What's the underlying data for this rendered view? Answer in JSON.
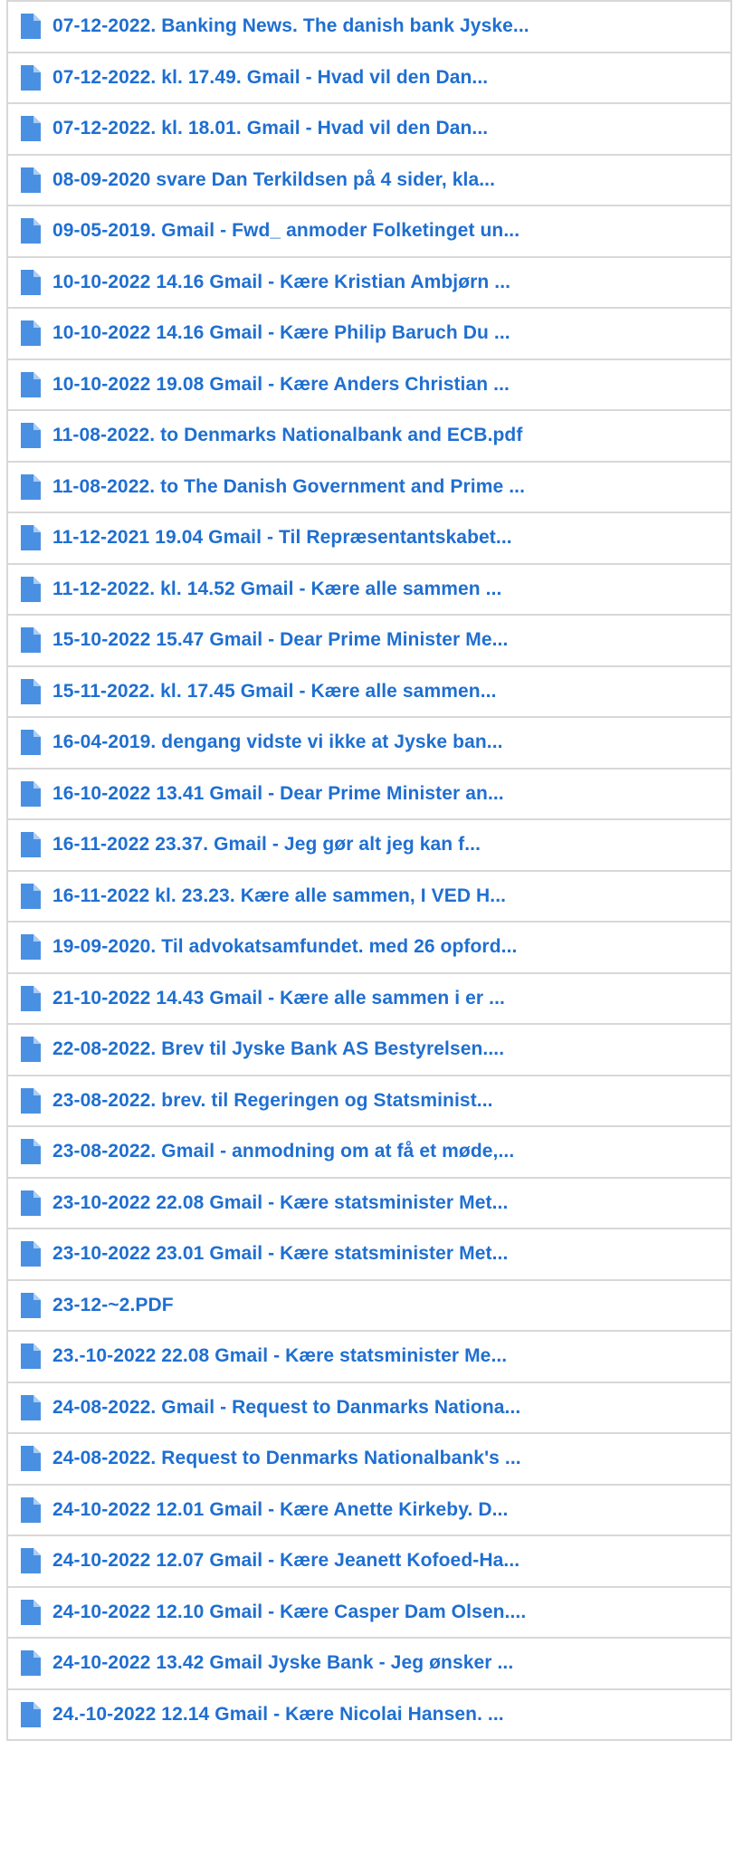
{
  "colors": {
    "link": "#1f6fd1",
    "icon": "#4a90e2",
    "border": "#d8d8d8"
  },
  "icon_name": "document-icon",
  "files": [
    {
      "label": "07-12-2022. Banking News. The danish bank Jyske..."
    },
    {
      "label": "07-12-2022. kl. 17.49. Gmail - Hvad vil den Dan..."
    },
    {
      "label": "07-12-2022. kl. 18.01. Gmail - Hvad vil den Dan..."
    },
    {
      "label": "08-09-2020 svare Dan Terkildsen på 4 sider, kla..."
    },
    {
      "label": "09-05-2019. Gmail - Fwd_ anmoder Folketinget un..."
    },
    {
      "label": "10-10-2022 14.16 Gmail - Kære Kristian Ambjørn ..."
    },
    {
      "label": "10-10-2022 14.16 Gmail - Kære Philip Baruch Du ..."
    },
    {
      "label": "10-10-2022 19.08 Gmail - Kære Anders Christian ..."
    },
    {
      "label": "11-08-2022. to Denmarks Nationalbank and ECB.pdf"
    },
    {
      "label": "11-08-2022. to The Danish Government and Prime ..."
    },
    {
      "label": "11-12-2021 19.04 Gmail - Til Repræsentantskabet..."
    },
    {
      "label": "11-12-2022. kl. 14.52 Gmail - Kære alle sammen ..."
    },
    {
      "label": "15-10-2022 15.47 Gmail - Dear Prime Minister Me..."
    },
    {
      "label": "15-11-2022. kl. 17.45 Gmail - Kære alle sammen..."
    },
    {
      "label": "16-04-2019. dengang vidste vi ikke at Jyske ban..."
    },
    {
      "label": "16-10-2022 13.41 Gmail - Dear Prime Minister an..."
    },
    {
      "label": "16-11-2022 23.37. Gmail - Jeg gør alt jeg kan f..."
    },
    {
      "label": "16-11-2022 kl. 23.23. Kære alle sammen, I VED H..."
    },
    {
      "label": "19-09-2020. Til advokatsamfundet. med 26 opford..."
    },
    {
      "label": "21-10-2022 14.43 Gmail - Kære alle sammen i er ..."
    },
    {
      "label": "22-08-2022. Brev til Jyske Bank AS Bestyrelsen...."
    },
    {
      "label": "23-08-2022. brev. til Regeringen og Statsminist..."
    },
    {
      "label": "23-08-2022. Gmail - anmodning om at få et møde,..."
    },
    {
      "label": "23-10-2022 22.08 Gmail - Kære statsminister Met..."
    },
    {
      "label": "23-10-2022 23.01 Gmail - Kære statsminister Met..."
    },
    {
      "label": "23-12-~2.PDF"
    },
    {
      "label": "23.-10-2022 22.08 Gmail - Kære statsminister Me..."
    },
    {
      "label": "24-08-2022. Gmail - Request to Danmarks Nationa..."
    },
    {
      "label": "24-08-2022. Request to Denmarks Nationalbank's ..."
    },
    {
      "label": "24-10-2022 12.01 Gmail - Kære Anette Kirkeby. D..."
    },
    {
      "label": "24-10-2022 12.07 Gmail - Kære Jeanett Kofoed-Ha..."
    },
    {
      "label": "24-10-2022 12.10 Gmail - Kære Casper Dam Olsen...."
    },
    {
      "label": "24-10-2022 13.42 Gmail Jyske Bank - Jeg ønsker ..."
    },
    {
      "label": "24.-10-2022 12.14 Gmail - Kære Nicolai Hansen. ..."
    }
  ]
}
